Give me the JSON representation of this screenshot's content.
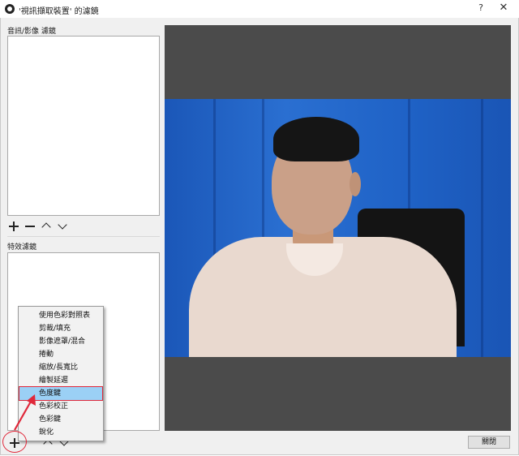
{
  "window": {
    "title": "'視訊擷取裝置' 的濾鏡",
    "help_glyph": "?",
    "close_glyph": "✕"
  },
  "audio_video_filters": {
    "label": "音訊/影像 濾鏡",
    "items": []
  },
  "effect_filters": {
    "label": "特效濾鏡",
    "items": []
  },
  "toolbar_icons": [
    "plus-icon",
    "minus-icon",
    "chevron-up-icon",
    "chevron-down-icon"
  ],
  "context_menu": {
    "items": [
      {
        "label": "使用色彩對照表"
      },
      {
        "label": "剪裁/填充"
      },
      {
        "label": "影像遮罩/混合"
      },
      {
        "label": "捲動"
      },
      {
        "label": "縮放/長寬比"
      },
      {
        "label": "繪製延遲"
      },
      {
        "label": "色度鍵",
        "selected": true
      },
      {
        "label": "色彩校正"
      },
      {
        "label": "色彩鍵"
      },
      {
        "label": "銳化"
      }
    ]
  },
  "footer": {
    "close_label": "關閉"
  },
  "colors": {
    "preview_background": "#4b4b4b",
    "blue_screen": "#1f62c6",
    "highlight": "#9bd0f5",
    "annotation_red": "#e0283a"
  }
}
